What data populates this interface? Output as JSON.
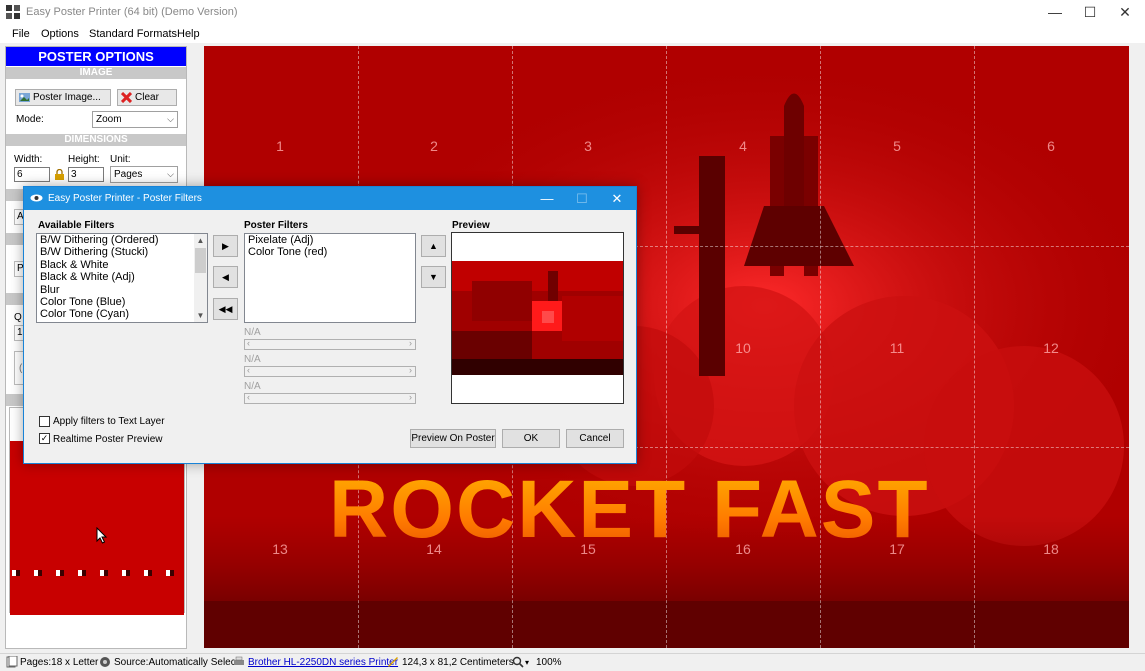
{
  "window": {
    "title": "Easy Poster Printer (64 bit) (Demo Version)",
    "min_glyph": "—",
    "max_glyph": "☐",
    "close_glyph": "✕"
  },
  "menu": [
    "File",
    "Options",
    "Standard Formats",
    "Help"
  ],
  "left_panel": {
    "header": "POSTER OPTIONS",
    "image_section": "IMAGE",
    "poster_image_button": "Poster Image...",
    "clear_button": "Clear",
    "mode_label": "Mode:",
    "mode_value": "Zoom",
    "dimensions_section": "DIMENSIONS",
    "width_label": "Width:",
    "height_label": "Height:",
    "unit_label": "Unit:",
    "width_value": "6",
    "height_value": "3",
    "unit_value": "Pages",
    "partial_a": "A",
    "partial_p": "P",
    "partial_q": "Q",
    "partial_15": "15",
    "partial_c": "("
  },
  "poster": {
    "text": "ROCKET FAST",
    "page_numbers": [
      "1",
      "2",
      "3",
      "4",
      "5",
      "6",
      "10",
      "11",
      "12",
      "13",
      "14",
      "15",
      "16",
      "17",
      "18"
    ]
  },
  "status_bar": {
    "pages": "Pages:18 x Letter",
    "source": "Source:Automatically Select",
    "printer": "Brother HL-2250DN series Printer",
    "size": "124,3 x 81,2 Centimeters",
    "zoom": "100%"
  },
  "dialog": {
    "title": "Easy Poster Printer - Poster Filters",
    "available_label": "Available Filters",
    "available_filters": [
      "B/W Dithering (Ordered)",
      "B/W Dithering (Stucki)",
      "Black & White",
      "Black & White (Adj)",
      "Blur",
      "Color Tone (Blue)",
      "Color Tone (Cyan)"
    ],
    "poster_label": "Poster Filters",
    "poster_filters": [
      "Pixelate (Adj)",
      "Color Tone (red)"
    ],
    "preview_label": "Preview",
    "param_labels": [
      "N/A",
      "N/A",
      "N/A"
    ],
    "apply_text_layer": "Apply filters to Text Layer",
    "apply_text_layer_checked": false,
    "realtime_preview": "Realtime Poster Preview",
    "realtime_preview_checked": true,
    "preview_on_poster_button": "Preview On Poster",
    "ok_button": "OK",
    "cancel_button": "Cancel"
  },
  "colors": {
    "accent_blue": "#0000ff",
    "dialog_title": "#1e90e0",
    "poster_red": "#a80000",
    "text_orange": "#ff8a00"
  }
}
